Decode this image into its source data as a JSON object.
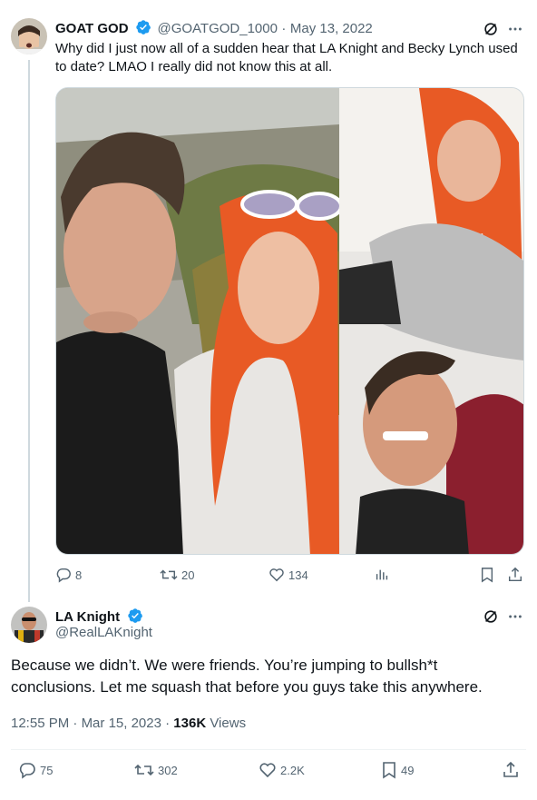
{
  "tweet1": {
    "display_name": "GOAT GOD",
    "handle": "@GOATGOD_1000",
    "separator": "·",
    "date": "May 13, 2022",
    "text": "Why did I just now all of a sudden hear that LA Knight and Becky Lynch used to date? LMAO I really did not know this at all.",
    "actions": {
      "replies": "8",
      "retweets": "20",
      "likes": "134"
    }
  },
  "tweet2": {
    "display_name": "LA Knight",
    "handle": "@RealLAKnight",
    "text": "Because we didn’t. We were friends. You’re jumping to bullsh*t conclusions. Let me squash that before you guys take this anywhere.",
    "time": "12:55 PM",
    "separator": "·",
    "date": "Mar 15, 2023",
    "separator2": "·",
    "views_count": "136K",
    "views_label": "Views",
    "actions": {
      "replies": "75",
      "retweets": "302",
      "likes": "2.2K",
      "bookmarks": "49"
    }
  },
  "colors": {
    "verified_blue": "#1d9bf0",
    "text_primary": "#0f1419",
    "text_secondary": "#536471"
  },
  "icons": [
    "verified-badge-icon",
    "grok-icon",
    "more-icon",
    "reply-icon",
    "retweet-icon",
    "like-icon",
    "views-icon",
    "bookmark-icon",
    "share-icon"
  ]
}
